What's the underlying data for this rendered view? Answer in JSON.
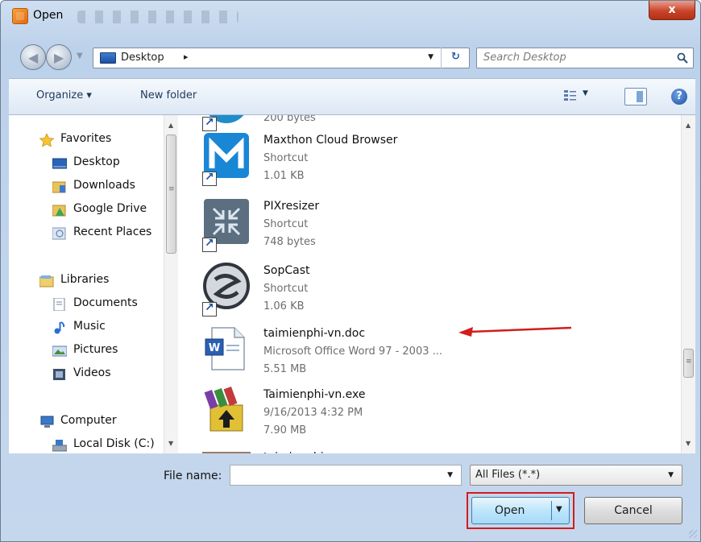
{
  "window": {
    "title": "Open",
    "close_label": "x"
  },
  "address": {
    "location": "Desktop",
    "chevron": "▸",
    "dropdown": "▼",
    "refresh": "↻"
  },
  "search": {
    "placeholder": "Search Desktop"
  },
  "toolbar": {
    "organize_label": "Organize ▾",
    "new_folder_label": "New folder",
    "view_dropdown": "▼",
    "help_label": "?"
  },
  "nav": {
    "favorites": [
      {
        "label": "Favorites",
        "icon": "star-icon"
      },
      {
        "label": "Desktop",
        "icon": "desktop-icon"
      },
      {
        "label": "Downloads",
        "icon": "downloads-icon"
      },
      {
        "label": "Google Drive",
        "icon": "google-drive-icon"
      },
      {
        "label": "Recent Places",
        "icon": "recent-places-icon"
      }
    ],
    "libraries": [
      {
        "label": "Libraries",
        "icon": "libraries-icon"
      },
      {
        "label": "Documents",
        "icon": "documents-icon"
      },
      {
        "label": "Music",
        "icon": "music-icon"
      },
      {
        "label": "Pictures",
        "icon": "pictures-icon"
      },
      {
        "label": "Videos",
        "icon": "videos-icon"
      }
    ],
    "computer": [
      {
        "label": "Computer",
        "icon": "computer-icon"
      },
      {
        "label": "Local Disk (C:)",
        "icon": "local-disk-icon"
      }
    ]
  },
  "files": [
    {
      "name": "",
      "line2": "200 bytes",
      "line3": "",
      "icon": "app-icon"
    },
    {
      "name": "Maxthon Cloud Browser",
      "line2": "Shortcut",
      "line3": "1.01 KB",
      "icon": "maxthon-icon"
    },
    {
      "name": "PIXresizer",
      "line2": "Shortcut",
      "line3": "748 bytes",
      "icon": "pixresizer-icon"
    },
    {
      "name": "SopCast",
      "line2": "Shortcut",
      "line3": "1.06 KB",
      "icon": "sopcast-icon"
    },
    {
      "name": "taimienphi-vn.doc",
      "line2": "Microsoft Office Word 97 - 2003 ...",
      "line3": "5.51 MB",
      "icon": "word-doc-icon"
    },
    {
      "name": "Taimienphi-vn.exe",
      "line2": "9/16/2013 4:32 PM",
      "line3": "7.90 MB",
      "icon": "winrar-exe-icon"
    },
    {
      "name": "taimienphi-vn",
      "line2": "",
      "line3": "",
      "icon": "file-icon"
    }
  ],
  "bottom": {
    "file_name_label": "File name:",
    "file_name_value": "",
    "filter_value": "All Files (*.*)",
    "open_label": "Open",
    "cancel_label": "Cancel"
  },
  "colors": {
    "accent": "#1d4f9e",
    "highlight": "#d21d1d",
    "annotation_arrow": "#d21d1d"
  }
}
